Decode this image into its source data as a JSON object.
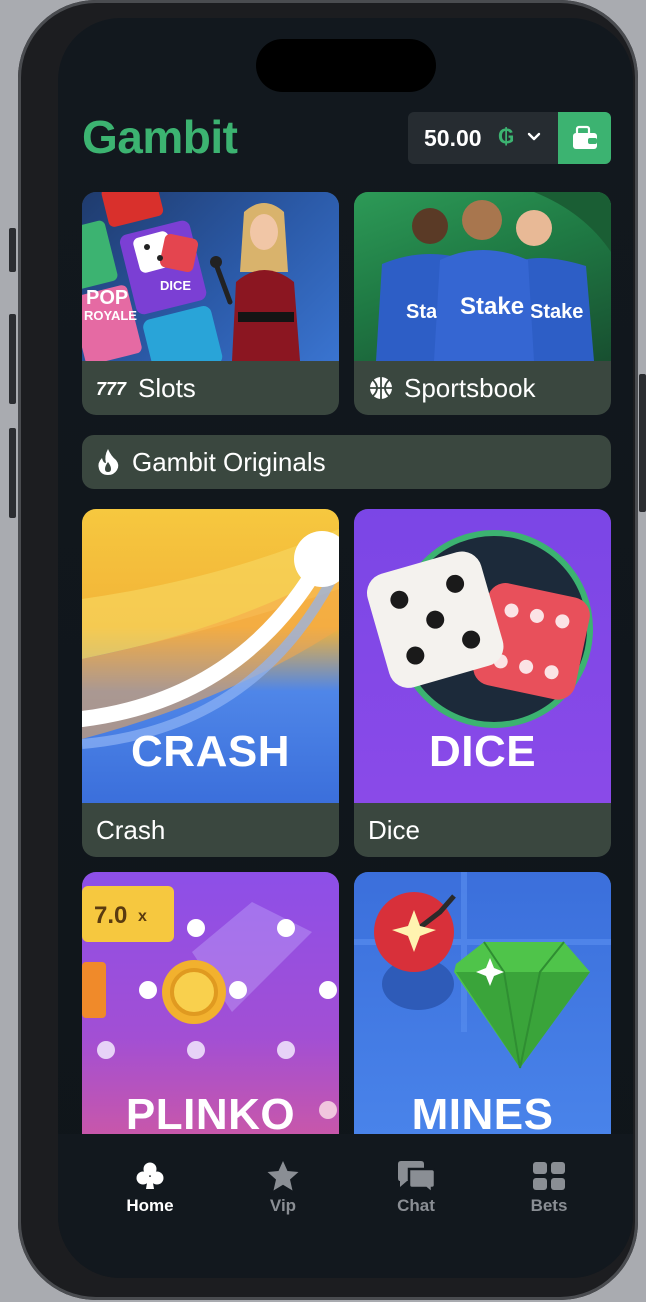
{
  "header": {
    "logo": "Gambit",
    "balance": "50.00",
    "currency_icon": "gambit-coin-icon",
    "dropdown_icon": "chevron-down-icon",
    "wallet_icon": "wallet-icon"
  },
  "categories": [
    {
      "label": "Slots",
      "icon": "slots-777-icon"
    },
    {
      "label": "Sportsbook",
      "icon": "basketball-icon"
    }
  ],
  "originals": {
    "label": "Gambit Originals",
    "icon": "fire-icon"
  },
  "games": [
    {
      "title": "CRASH",
      "label": "Crash"
    },
    {
      "title": "DICE",
      "label": "Dice"
    },
    {
      "title": "PLINKO",
      "multiplier": "7.0",
      "multiplier_suffix": "x"
    },
    {
      "title": "MINES"
    }
  ],
  "promo": {
    "slots_tiles": [
      "POP",
      "ROYALE",
      "DICE"
    ],
    "jersey_text": "Stake"
  },
  "tabbar": [
    {
      "label": "Home",
      "icon": "club-icon",
      "active": true
    },
    {
      "label": "Vip",
      "icon": "star-icon",
      "active": false
    },
    {
      "label": "Chat",
      "icon": "chat-bubbles-icon",
      "active": false
    },
    {
      "label": "Bets",
      "icon": "grid-icon",
      "active": false
    }
  ],
  "colors": {
    "brand": "#3cb371",
    "card": "#3a473f",
    "background": "#12181e"
  }
}
